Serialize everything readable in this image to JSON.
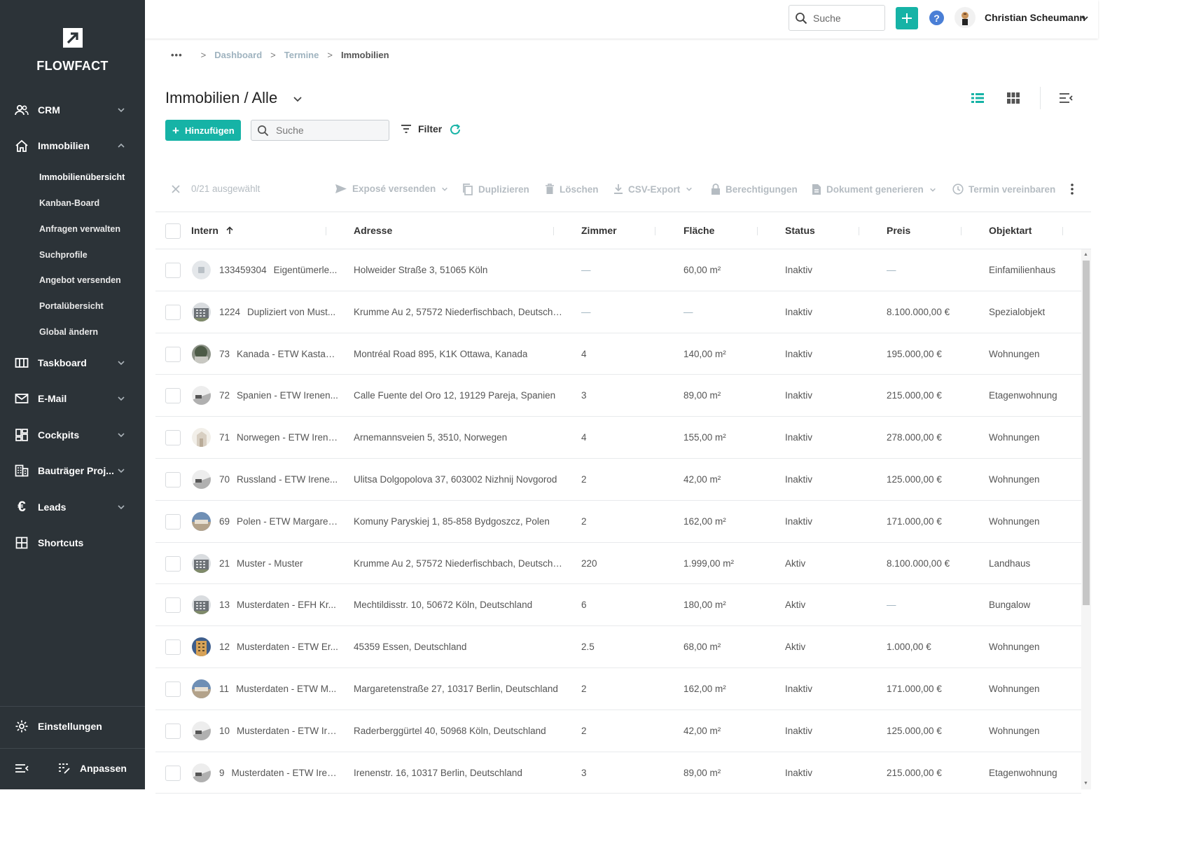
{
  "brand": {
    "name": "FLOWFACT"
  },
  "sidebar": {
    "items": [
      {
        "label": "CRM",
        "icon": "people-icon"
      },
      {
        "label": "Immobilien",
        "icon": "home-icon"
      },
      {
        "label": "Taskboard",
        "icon": "board-icon"
      },
      {
        "label": "E-Mail",
        "icon": "mail-icon"
      },
      {
        "label": "Cockpits",
        "icon": "dashboard-icon"
      },
      {
        "label": "Bauträger Proj...",
        "icon": "building-icon"
      },
      {
        "label": "Leads",
        "icon": "euro-icon"
      },
      {
        "label": "Shortcuts",
        "icon": "shortcuts-icon"
      }
    ],
    "subitems": [
      "Immobilienübersicht",
      "Kanban-Board",
      "Anfragen verwalten",
      "Suchprofile",
      "Angebot versenden",
      "Portalübersicht",
      "Global ändern"
    ],
    "settings_label": "Einstellungen",
    "customize_label": "Anpassen"
  },
  "topbar": {
    "search_placeholder": "Suche",
    "help_label": "?",
    "user_name": "Christian Scheumann"
  },
  "breadcrumb": {
    "dots": "•••",
    "sep": ">",
    "items": [
      "Dashboard",
      "Termine",
      "Immobilien"
    ]
  },
  "page": {
    "title": "Immobilien / Alle",
    "add_label": "Hinzufügen",
    "search_placeholder": "Suche",
    "filter_label": "Filter"
  },
  "actions": {
    "selected": "0/21 ausgewählt",
    "expose": "Exposé versenden",
    "duplicate": "Duplizieren",
    "delete": "Löschen",
    "csv": "CSV-Export",
    "permissions": "Berechtigungen",
    "document": "Dokument generieren",
    "appointment": "Termin vereinbaren"
  },
  "table": {
    "columns": [
      "Intern",
      "Adresse",
      "Zimmer",
      "Fläche",
      "Status",
      "Preis",
      "Objektart"
    ],
    "rows": [
      {
        "nr": "133459304",
        "title": "Eigentümerle...",
        "address": "Holweider Straße 3, 51065 Köln",
        "rooms": "—",
        "area": "60,00 m²",
        "status": "Inaktiv",
        "price": "—",
        "type": "Einfamilienhaus",
        "thumb": "placeholder"
      },
      {
        "nr": "1224",
        "title": "Dupliziert von Must...",
        "address": "Krumme Au 2, 57572 Niederfischbach, Deutschla...",
        "rooms": "—",
        "area": "—",
        "status": "Inaktiv",
        "price": "8.100.000,00 €",
        "type": "Spezialobjekt",
        "thumb": "building"
      },
      {
        "nr": "73",
        "title": "Kanada - ETW Kastani...",
        "address": "Montréal Road 895, K1K Ottawa, Kanada",
        "rooms": "4",
        "area": "140,00 m²",
        "status": "Inaktiv",
        "price": "195.000,00 €",
        "type": "Wohnungen",
        "thumb": "tree"
      },
      {
        "nr": "72",
        "title": "Spanien - ETW Irenen...",
        "address": "Calle Fuente del Oro 12, 19129 Pareja, Spanien",
        "rooms": "3",
        "area": "89,00 m²",
        "status": "Inaktiv",
        "price": "215.000,00 €",
        "type": "Etagenwohnung",
        "thumb": "interior"
      },
      {
        "nr": "71",
        "title": "Norwegen - ETW Irene...",
        "address": "Arnemannsveien 5, 3510, Norwegen",
        "rooms": "4",
        "area": "155,00 m²",
        "status": "Inaktiv",
        "price": "278.000,00 €",
        "type": "Wohnungen",
        "thumb": "light"
      },
      {
        "nr": "70",
        "title": "Russland - ETW Irene...",
        "address": "Ulitsa Dolgopolova 37, 603002 Nizhnij Novgorod",
        "rooms": "2",
        "area": "42,00 m²",
        "status": "Inaktiv",
        "price": "125.000,00 €",
        "type": "Wohnungen",
        "thumb": "interior"
      },
      {
        "nr": "69",
        "title": "Polen - ETW Margaret...",
        "address": "Komuny Paryskiej 1, 85-858 Bydgoszcz, Polen",
        "rooms": "2",
        "area": "162,00 m²",
        "status": "Inaktiv",
        "price": "171.000,00 €",
        "type": "Wohnungen",
        "thumb": "sky"
      },
      {
        "nr": "21",
        "title": "Muster - Muster",
        "address": "Krumme Au 2, 57572 Niederfischbach, Deutschla...",
        "rooms": "220",
        "area": "1.999,00 m²",
        "status": "Aktiv",
        "price": "8.100.000,00 €",
        "type": "Landhaus",
        "thumb": "building"
      },
      {
        "nr": "13",
        "title": "Musterdaten - EFH Kr...",
        "address": "Mechtildisstr. 10, 50672 Köln, Deutschland",
        "rooms": "6",
        "area": "180,00 m²",
        "status": "Aktiv",
        "price": "—",
        "type": "Bungalow",
        "thumb": "building"
      },
      {
        "nr": "12",
        "title": "Musterdaten - ETW Er...",
        "address": "45359 Essen, Deutschland",
        "rooms": "2.5",
        "area": "68,00 m²",
        "status": "Aktiv",
        "price": "1.000,00 €",
        "type": "Wohnungen",
        "thumb": "blue"
      },
      {
        "nr": "11",
        "title": "Musterdaten - ETW M...",
        "address": "Margaretenstraße 27, 10317 Berlin, Deutschland",
        "rooms": "2",
        "area": "162,00 m²",
        "status": "Inaktiv",
        "price": "171.000,00 €",
        "type": "Wohnungen",
        "thumb": "sky"
      },
      {
        "nr": "10",
        "title": "Musterdaten - ETW Ire...",
        "address": "Raderberggürtel 40, 50968 Köln, Deutschland",
        "rooms": "2",
        "area": "42,00 m²",
        "status": "Inaktiv",
        "price": "125.000,00 €",
        "type": "Wohnungen",
        "thumb": "interior"
      },
      {
        "nr": "9",
        "title": "Musterdaten - ETW Iren...",
        "address": "Irenenstr. 16, 10317 Berlin, Deutschland",
        "rooms": "3",
        "area": "89,00 m²",
        "status": "Inaktiv",
        "price": "215.000,00 €",
        "type": "Etagenwohnung",
        "thumb": "interior"
      }
    ]
  },
  "colors": {
    "accent": "#16b3a6",
    "sidebar": "#2c3338",
    "muted": "#b5bcc2",
    "link": "#9fb3bf"
  }
}
